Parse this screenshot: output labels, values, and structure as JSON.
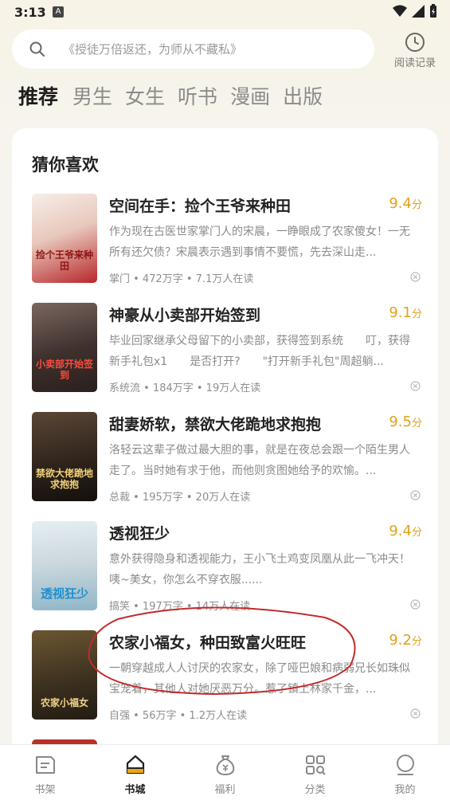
{
  "status_bar": {
    "time": "3:13",
    "badge": "A"
  },
  "search": {
    "placeholder": "《授徒万倍返还，为师从不藏私》",
    "icon": "search-icon"
  },
  "history": {
    "label": "阅读记录",
    "icon": "clock-icon"
  },
  "tabs": [
    {
      "label": "推荐",
      "active": true
    },
    {
      "label": "男生",
      "active": false
    },
    {
      "label": "女生",
      "active": false
    },
    {
      "label": "听书",
      "active": false
    },
    {
      "label": "漫画",
      "active": false
    },
    {
      "label": "出版",
      "active": false
    }
  ],
  "section": {
    "title": "猜你喜欢"
  },
  "books": [
    {
      "title": "空间在手：捡个王爷来种田",
      "score": "9.4",
      "score_unit": "分",
      "desc": "作为现在古医世家掌门人的宋晨，一睁眼成了农家傻女！一无所有还欠债？宋晨表示遇到事情不要慌，先去深山走...",
      "meta": "掌门 • 472万字 • 7.1万人在读",
      "cover_text": "捡个王爷来种田",
      "cover_colors": [
        "#f3e9e2",
        "#c2322b"
      ]
    },
    {
      "title": "神豪从小卖部开始签到",
      "score": "9.1",
      "score_unit": "分",
      "desc": "毕业回家继承父母留下的小卖部，获得签到系统　　叮，获得新手礼包x1　　是否打开?　　\"打开新手礼包\"周超躺...",
      "meta": "系统流 • 184万字 • 19万人在读",
      "cover_text": "小卖部开始签到",
      "cover_colors": [
        "#4a3a35",
        "#c8383a"
      ]
    },
    {
      "title": "甜妻娇软，禁欲大佬跪地求抱抱",
      "score": "9.5",
      "score_unit": "分",
      "desc": "洛轻云这辈子做过最大胆的事，就是在夜总会跟一个陌生男人走了。当时她有求于他，而他则贪图她给予的欢愉。...",
      "meta": "总裁 • 195万字 • 20万人在读",
      "cover_text": "禁欲大佬跪地求抱抱",
      "cover_colors": [
        "#3a2e26",
        "#1c1612"
      ]
    },
    {
      "title": "透视狂少",
      "score": "9.4",
      "score_unit": "分",
      "desc": "意外获得隐身和透视能力，王小飞土鸡变凤凰从此一飞冲天！咦~美女，你怎么不穿衣服......",
      "meta": "搞笑 • 197万字 • 14万人在读",
      "cover_text": "透视狂少",
      "cover_colors": [
        "#d9e8ef",
        "#2e9fd8"
      ]
    },
    {
      "title": "农家小福女，种田致富火旺旺",
      "score": "9.2",
      "score_unit": "分",
      "desc": "一朝穿越成人人讨厌的农家女，除了哑巴娘和病弱兄长如珠似宝宠着，其他人对她厌恶万分。惹了镇上林家千金，...",
      "meta": "自强 • 56万字 • 1.2万人在读",
      "cover_text": "农家小福女",
      "cover_colors": [
        "#5a4a2c",
        "#2c2418"
      ]
    }
  ],
  "bottom_nav": [
    {
      "label": "书架",
      "icon": "bookshelf-icon",
      "active": false
    },
    {
      "label": "书城",
      "icon": "bookstore-icon",
      "active": true
    },
    {
      "label": "福利",
      "icon": "coin-bag-icon",
      "active": false
    },
    {
      "label": "分类",
      "icon": "category-grid-icon",
      "active": false
    },
    {
      "label": "我的",
      "icon": "profile-icon",
      "active": false
    }
  ],
  "colors": {
    "accent": "#e0a21c",
    "annotation": "#c42a2a"
  }
}
